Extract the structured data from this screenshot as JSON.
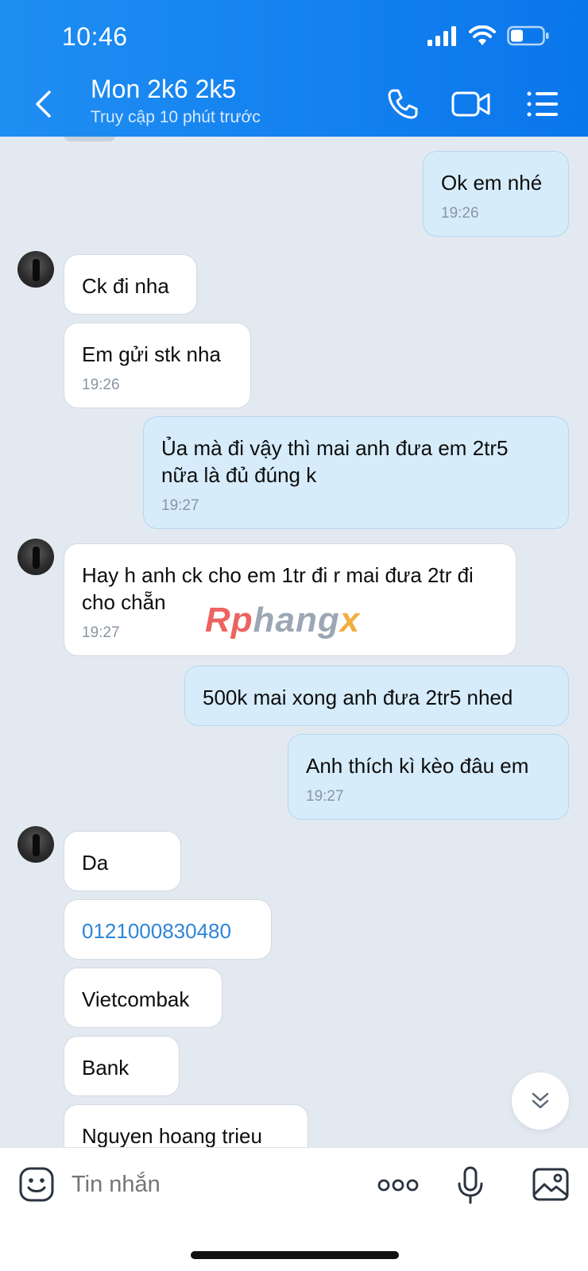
{
  "status_bar": {
    "time": "10:46"
  },
  "header": {
    "title": "Mon 2k6 2k5",
    "subtitle": "Truy cập 10 phút trước",
    "icons": [
      "chevron-left-icon",
      "phone-icon",
      "video-call-icon",
      "menu-list-icon"
    ]
  },
  "messages": [
    {
      "dir": "out",
      "text": "Ok em nhé",
      "time": "19:26"
    },
    {
      "dir": "in",
      "text": "Ck đi nha",
      "time": ""
    },
    {
      "dir": "in",
      "text": "Em gửi stk nha",
      "time": "19:26"
    },
    {
      "dir": "out",
      "text": "Ủa mà đi vậy thì mai anh đưa em 2tr5 nữa là đủ đúng k",
      "time": "19:27"
    },
    {
      "dir": "in",
      "text": "Hay h anh ck cho em 1tr đi r mai đưa 2tr đi cho chẵn",
      "time": "19:27"
    },
    {
      "dir": "out",
      "text": "500k mai xong anh đưa 2tr5 nhed",
      "time": ""
    },
    {
      "dir": "out",
      "text": "Anh thích kì kèo đâu em",
      "time": "19:27"
    },
    {
      "dir": "in",
      "text": "Da",
      "time": ""
    },
    {
      "dir": "in",
      "text": "0121000830480",
      "time": "",
      "is_link": true
    },
    {
      "dir": "in",
      "text": "Vietcombak",
      "time": ""
    },
    {
      "dir": "in",
      "text": "Bank",
      "time": ""
    },
    {
      "dir": "in",
      "text": "Nguyen hoang trieu",
      "time": ""
    }
  ],
  "watermark": {
    "part1": "Rp",
    "part2": "hang",
    "part3": "x"
  },
  "input": {
    "placeholder": "Tin nhắn",
    "icons": [
      "emoji-sticker-icon",
      "more-dots-icon",
      "microphone-icon",
      "image-gallery-icon"
    ]
  },
  "colors": {
    "header": "#0a76ec",
    "background": "#e2e9f1",
    "outgoing_bubble": "#d6ecfa",
    "incoming_bubble": "#ffffff",
    "link": "#2e85d8"
  }
}
